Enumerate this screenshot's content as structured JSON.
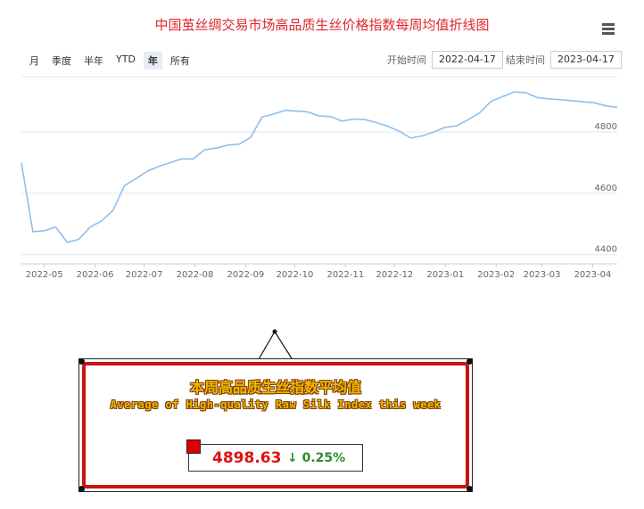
{
  "title": "中国茧丝绸交易市场高品质生丝价格指数每周均值折线图",
  "menu_icon": "hamburger-menu-icon",
  "range_buttons": [
    "月",
    "季度",
    "半年",
    "YTD",
    "年",
    "所有"
  ],
  "selected_range": "年",
  "start_label": "开始时间",
  "start_date": "2022-04-17",
  "end_label": "结束时间",
  "end_date": "2023-04-17",
  "line_color": "#8cbff0",
  "chart_data": {
    "type": "line",
    "title": "中国茧丝绸交易市场高品质生丝价格指数每周均值折线图",
    "xlabel": "",
    "ylabel": "",
    "ylim": [
      4370,
      4980
    ],
    "yticks": [
      4400,
      4600,
      4800
    ],
    "x_tick_labels": [
      "2022-05",
      "2022-06",
      "2022-07",
      "2022-08",
      "2022-09",
      "2022-10",
      "2022-11",
      "2022-12",
      "2023-01",
      "2023-02",
      "2023-03",
      "2023-04"
    ],
    "x_tick_dates": [
      "2022-05-01",
      "2022-06-01",
      "2022-07-01",
      "2022-08-01",
      "2022-09-01",
      "2022-10-01",
      "2022-11-01",
      "2022-12-01",
      "2023-01-01",
      "2023-02-01",
      "2023-03-01",
      "2023-04-01"
    ],
    "grid": true,
    "series": [
      {
        "x": [
          "2022-04-17",
          "2022-04-24",
          "2022-05-01",
          "2022-05-08",
          "2022-05-15",
          "2022-05-22",
          "2022-05-29",
          "2022-06-05",
          "2022-06-12",
          "2022-06-19",
          "2022-06-26",
          "2022-07-03",
          "2022-07-10",
          "2022-07-17",
          "2022-07-24",
          "2022-07-31",
          "2022-08-07",
          "2022-08-14",
          "2022-08-21",
          "2022-08-28",
          "2022-09-04",
          "2022-09-11",
          "2022-09-18",
          "2022-09-25",
          "2022-10-02",
          "2022-10-09",
          "2022-10-16",
          "2022-10-23",
          "2022-10-30",
          "2022-11-06",
          "2022-11-13",
          "2022-11-20",
          "2022-11-27",
          "2022-12-04",
          "2022-12-11",
          "2022-12-18",
          "2022-12-25",
          "2023-01-01",
          "2023-01-08",
          "2023-01-15",
          "2023-01-22",
          "2023-01-29",
          "2023-02-05",
          "2023-02-12",
          "2023-02-19",
          "2023-02-26",
          "2023-03-05",
          "2023-03-12",
          "2023-03-19",
          "2023-03-26",
          "2023-04-02",
          "2023-04-09",
          "2023-04-16"
        ],
        "values": [
          4700,
          4475,
          4478,
          4490,
          4440,
          4450,
          4490,
          4510,
          4545,
          4625,
          4648,
          4672,
          4688,
          4700,
          4712,
          4712,
          4742,
          4747,
          4757,
          4760,
          4782,
          4848,
          4858,
          4870,
          4868,
          4865,
          4852,
          4850,
          4835,
          4842,
          4840,
          4830,
          4818,
          4802,
          4780,
          4787,
          4800,
          4815,
          4820,
          4840,
          4862,
          4900,
          4915,
          4930,
          4928,
          4912,
          4908,
          4905,
          4902,
          4898,
          4895,
          4885,
          4880
        ]
      }
    ]
  },
  "callout": {
    "title_cn": "本周高品质生丝指数平均值",
    "title_en": "Average of High-quality Raw Silk Index this week",
    "value": "4898.63",
    "change": "↓ 0.25%"
  }
}
